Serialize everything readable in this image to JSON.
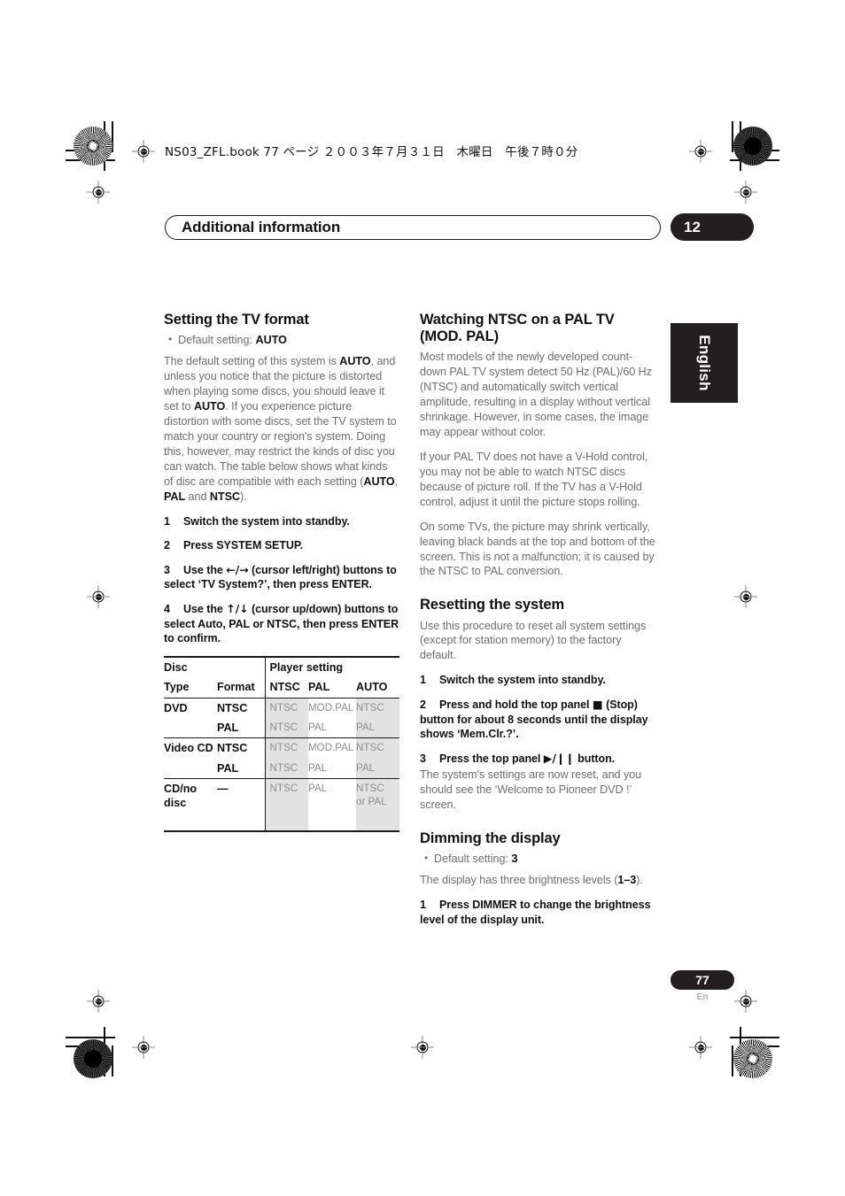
{
  "slug": "NS03_ZFL.book  77 ページ  ２００３年７月３１日　木曜日　午後７時０分",
  "header": {
    "title": "Additional information",
    "chapter": "12",
    "language_tab": "English"
  },
  "footer": {
    "page_number": "77",
    "language_code": "En"
  },
  "left_column": {
    "section1": {
      "heading": "Setting the TV format",
      "bullet_prefix": "Default setting: ",
      "bullet_value": "AUTO",
      "paragraph_parts": [
        "The default setting of this system is ",
        "AUTO",
        ", and unless you notice that the picture is distorted when playing some discs, you should leave it set to ",
        "AUTO",
        ". If you experience picture distortion with some discs, set the TV system to match your country or region's system. Doing this, however, may restrict the kinds of disc you can watch. The table below shows what kinds of disc are compatible with each setting (",
        "AUTO",
        ", ",
        "PAL",
        " and ",
        "NTSC",
        ")."
      ],
      "steps": [
        {
          "n": "1",
          "text": "Switch the system into standby."
        },
        {
          "n": "2",
          "text": "Press SYSTEM SETUP."
        },
        {
          "n": "3",
          "text_before": "Use the ",
          "glyph": "←/→",
          "text_after": " (cursor left/right) buttons to select ‘TV System?’, then press ENTER."
        },
        {
          "n": "4",
          "text_before": "Use the ",
          "glyph": "↑/↓",
          "text_after": " (cursor up/down) buttons to select Auto, PAL or NTSC, then press ENTER to confirm."
        }
      ]
    },
    "table": {
      "group_header_left": "Disc",
      "group_header_right": "Player setting",
      "columns": [
        "Type",
        "Format",
        "NTSC",
        "PAL",
        "AUTO"
      ],
      "rows": [
        {
          "type": "DVD",
          "format": "NTSC",
          "ntsc": "NTSC",
          "pal": "MOD.PAL",
          "auto": "NTSC"
        },
        {
          "type": "",
          "format": "PAL",
          "ntsc": "NTSC",
          "pal": "PAL",
          "auto": "PAL"
        },
        {
          "type": "Video CD",
          "format": "NTSC",
          "ntsc": "NTSC",
          "pal": "MOD.PAL",
          "auto": "NTSC"
        },
        {
          "type": "",
          "format": "PAL",
          "ntsc": "NTSC",
          "pal": "PAL",
          "auto": "PAL"
        },
        {
          "type": "CD/no disc",
          "format": "—",
          "ntsc": "NTSC",
          "pal": "PAL",
          "auto": "NTSC or PAL"
        }
      ]
    }
  },
  "right_column": {
    "section2": {
      "heading_line1": "Watching NTSC on a PAL TV",
      "heading_line2": "(MOD. PAL)",
      "paragraphs": [
        "Most models of the newly developed count-down PAL TV system detect 50 Hz (PAL)/60 Hz (NTSC) and automatically switch vertical amplitude, resulting in a display without vertical shrinkage. However, in some cases, the image may appear without color.",
        "If your PAL TV does not have a V-Hold control, you may not be able to watch NTSC discs because of picture roll. If the TV has a V-Hold control, adjust it until the picture stops rolling.",
        "On some TVs, the picture may shrink vertically, leaving black bands at the top and bottom of the screen. This is not a malfunction; it is caused by the NTSC to PAL conversion."
      ]
    },
    "section3": {
      "heading": "Resetting the system",
      "intro": "Use this procedure to reset all system settings (except for station memory) to the factory default.",
      "steps": [
        {
          "n": "1",
          "text": "Switch the system into standby."
        },
        {
          "n": "2",
          "text_before": "Press and hold the top panel ",
          "glyph": "■",
          "text_after": " (Stop) button for about 8 seconds until the display shows ‘Mem.Clr.?’."
        },
        {
          "n": "3",
          "text_before": "Press the top panel ",
          "glyph": "▶/❙❙",
          "text_after": " button."
        }
      ],
      "closing_note": "The system's settings are now reset, and you should see the ‘Welcome to Pioneer DVD !’ screen."
    },
    "section4": {
      "heading": "Dimming the display",
      "bullet_prefix": "Default setting: ",
      "bullet_value": "3",
      "note_before": "The display has three brightness levels (",
      "note_value": "1–3",
      "note_after": ").",
      "step": {
        "n": "1",
        "text": "Press DIMMER to change the brightness level of the display unit."
      }
    }
  },
  "colors": {
    "ink_black": "#231f20",
    "body_gray": "#6e6e6e",
    "table_gray_text": "#8d8d8d",
    "shade": "#e2e2e2"
  }
}
